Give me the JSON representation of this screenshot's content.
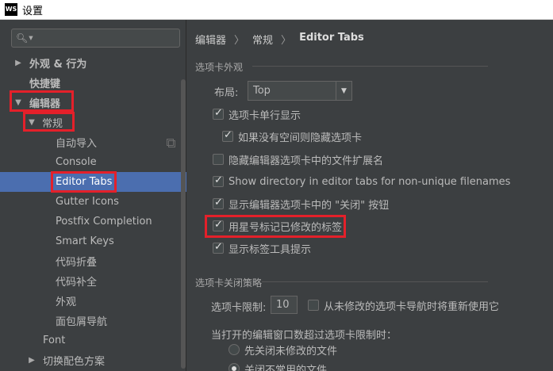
{
  "window": {
    "logo_text": "WS",
    "title": "设置"
  },
  "sidebar": {
    "search_placeholder": "",
    "items": [
      {
        "label": "外观 & 行为",
        "arrow": "▶"
      },
      {
        "label": "快捷键",
        "arrow": ""
      },
      {
        "label": "编辑器",
        "arrow": "▼"
      },
      {
        "label": "常规",
        "arrow": "▼"
      },
      {
        "label": "自动导入"
      },
      {
        "label": "Console"
      },
      {
        "label": "Editor Tabs"
      },
      {
        "label": "Gutter Icons"
      },
      {
        "label": "Postfix Completion"
      },
      {
        "label": "Smart Keys"
      },
      {
        "label": "代码折叠"
      },
      {
        "label": "代码补全"
      },
      {
        "label": "外观"
      },
      {
        "label": "面包屑导航"
      },
      {
        "label": "Font"
      },
      {
        "label": "切换配色方案",
        "arrow": "▶"
      }
    ]
  },
  "breadcrumb": {
    "part1": "编辑器",
    "part2": "常规",
    "part3": "Editor Tabs",
    "sep": "〉"
  },
  "appearance": {
    "title": "选项卡外观",
    "placement_label": "布局:",
    "placement_value": "Top",
    "options": [
      {
        "label": "选项卡单行显示",
        "checked": true
      },
      {
        "label": "如果没有空间则隐藏选项卡",
        "checked": true
      },
      {
        "label": "隐藏编辑器选项卡中的文件扩展名",
        "checked": false
      },
      {
        "label": "Show directory in editor tabs for non-unique filenames",
        "checked": true
      },
      {
        "label": "显示编辑器选项卡中的 \"关闭\" 按钮",
        "checked": true
      },
      {
        "label": "用星号标记已修改的标签",
        "checked": true
      },
      {
        "label": "显示标签工具提示",
        "checked": true
      }
    ]
  },
  "closing": {
    "title": "选项卡关闭策略",
    "limit_label": "选项卡限制:",
    "limit_value": "10",
    "reuse_label": "从未修改的选项卡导航时将重新使用它",
    "reuse_checked": false,
    "when_exceeded_label": "当打开的编辑窗口数超过选项卡限制时：",
    "radio1": "先关闭未修改的文件",
    "radio1_checked": false,
    "radio2": "关闭不常用的文件",
    "radio2_checked": true
  },
  "colors": {
    "background": "#3c3f41",
    "selection": "#4b6eaf",
    "highlight_box": "#e4202a"
  }
}
